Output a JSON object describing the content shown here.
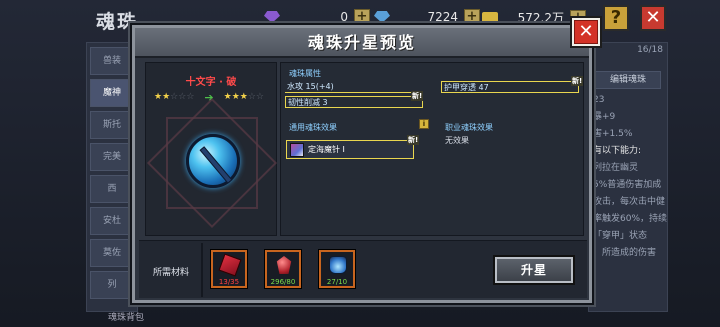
{
  "background": {
    "title": "魂珠",
    "resources": [
      {
        "icon": "purple-gem-icon",
        "value": "0",
        "color": "#8a5ad0"
      },
      {
        "icon": "blue-crystal-icon",
        "value": "7224",
        "color": "#5aa0d8"
      },
      {
        "icon": "gold-chest-icon",
        "value": "572.2万",
        "color": "#d8b640"
      }
    ],
    "help_label": "?",
    "close_label": "✕",
    "left_tabs": [
      "兽装",
      "魔神",
      "斯托",
      "完美",
      "西",
      "安杜",
      "莫佐",
      "列"
    ],
    "right_panel": {
      "count": "16/18",
      "tab_label": "编辑魂珠",
      "lines": [
        "23",
        "暴+9",
        "害+1.5%",
        "有以下能力:",
        "列拉在幽灵",
        "5%普通伤害加成",
        "攻击，每次击中健",
        "率触发60%，持续2",
        "「穿甲」状态",
        "，所造成的伤害"
      ]
    },
    "bottom_label": "魂珠背包"
  },
  "modal": {
    "title": "魂珠升星预览",
    "close_label": "✕",
    "item": {
      "name": "十文字 · 破",
      "stars_before": 2,
      "stars_after": 3,
      "stars_total": 5,
      "arrow": "➔"
    },
    "attributes": {
      "title": "魂珠属性",
      "water_attack": "水攻 15(+4)",
      "armor_pierce": "护甲穿透 47",
      "toughness_reduce": "韧性削减 3",
      "new_tag": "新!"
    },
    "general_effects": {
      "title": "通用魂珠效果",
      "skill": "定海魔针 I",
      "badge": "i"
    },
    "class_effects": {
      "title": "职业魂珠效果",
      "value": "无效果"
    },
    "materials": {
      "label": "所需材料",
      "items": [
        {
          "icon": "red-scroll-icon",
          "count": "13/35",
          "status": "insufficient"
        },
        {
          "icon": "red-crystal-icon",
          "count": "296/80",
          "status": "enough"
        },
        {
          "icon": "star-bottle-icon",
          "count": "27/10",
          "status": "enough"
        }
      ]
    },
    "upgrade_button": "升星"
  }
}
